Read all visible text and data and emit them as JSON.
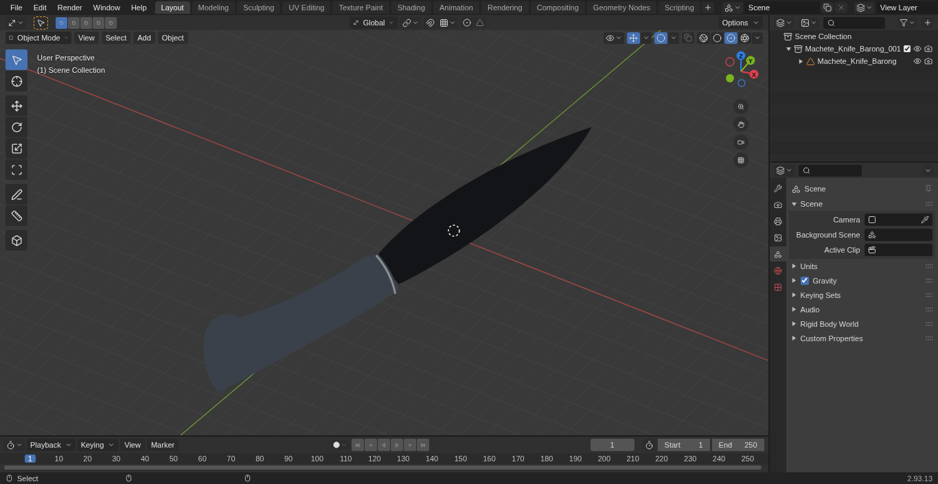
{
  "menu": [
    "File",
    "Edit",
    "Render",
    "Window",
    "Help"
  ],
  "workspaces": [
    {
      "label": "Layout",
      "selected": true
    },
    {
      "label": "Modeling",
      "selected": false
    },
    {
      "label": "Sculpting",
      "selected": false
    },
    {
      "label": "UV Editing",
      "selected": false
    },
    {
      "label": "Texture Paint",
      "selected": false
    },
    {
      "label": "Shading",
      "selected": false
    },
    {
      "label": "Animation",
      "selected": false
    },
    {
      "label": "Rendering",
      "selected": false
    },
    {
      "label": "Compositing",
      "selected": false
    },
    {
      "label": "Geometry Nodes",
      "selected": false
    },
    {
      "label": "Scripting",
      "selected": false
    }
  ],
  "scene": {
    "value": "Scene"
  },
  "view_layer": {
    "value": "View Layer"
  },
  "viewport": {
    "select_modes": [
      {
        "selected": true
      },
      {
        "selected": false
      },
      {
        "selected": false
      },
      {
        "selected": false
      },
      {
        "selected": false
      }
    ],
    "orientation": "Global",
    "options": "Options",
    "mode": "Object Mode",
    "menus": [
      "View",
      "Select",
      "Add",
      "Object"
    ],
    "shading": [
      {
        "kind": "wireframe",
        "selected": false
      },
      {
        "kind": "solid",
        "selected": false
      },
      {
        "kind": "material",
        "selected": true
      },
      {
        "kind": "rendered",
        "selected": false
      }
    ],
    "overlay_lines": [
      "User Perspective",
      "(1) Scene Collection"
    ],
    "tools": [
      [
        {
          "kind": "select",
          "selected": true
        },
        {
          "kind": "cursor",
          "selected": false
        }
      ],
      [
        {
          "kind": "move",
          "selected": false
        },
        {
          "kind": "rotate",
          "selected": false
        },
        {
          "kind": "scale",
          "selected": false
        },
        {
          "kind": "transform",
          "selected": false
        }
      ],
      [
        {
          "kind": "annotate",
          "selected": false
        },
        {
          "kind": "measure",
          "selected": false
        }
      ],
      [
        {
          "kind": "add_cube",
          "selected": false
        }
      ]
    ],
    "gizmo_axes": [
      "Z",
      "Y",
      "X"
    ]
  },
  "outliner": {
    "root": "Scene Collection",
    "items": [
      {
        "label": "Machete_Knife_Barong_001",
        "kind": "collection",
        "expanded": true,
        "checked": true,
        "children": [
          {
            "label": "Machete_Knife_Barong",
            "kind": "object",
            "expanded": false
          }
        ]
      }
    ]
  },
  "properties": {
    "tabs": [
      {
        "kind": "tool",
        "selected": false
      },
      {
        "kind": "render",
        "selected": false
      },
      {
        "kind": "output",
        "selected": false
      },
      {
        "kind": "view_layer",
        "selected": false
      },
      {
        "kind": "scene",
        "selected": true
      },
      {
        "kind": "world",
        "selected": false
      },
      {
        "kind": "texture",
        "selected": false
      }
    ],
    "context": "Scene",
    "panel": {
      "title": "Scene",
      "expanded": true,
      "fields": [
        {
          "label": "Camera",
          "kind": "camera"
        },
        {
          "label": "Background Scene",
          "kind": "scene"
        },
        {
          "label": "Active Clip",
          "kind": "clip"
        }
      ]
    },
    "sections": [
      {
        "label": "Units",
        "kind": "plain",
        "expanded": false
      },
      {
        "label": "Gravity",
        "kind": "checkbox",
        "checked": true,
        "expanded": false
      },
      {
        "label": "Keying Sets",
        "kind": "plain",
        "expanded": false
      },
      {
        "label": "Audio",
        "kind": "plain",
        "expanded": false
      },
      {
        "label": "Rigid Body World",
        "kind": "plain",
        "expanded": false
      },
      {
        "label": "Custom Properties",
        "kind": "plain",
        "expanded": false
      }
    ]
  },
  "timeline": {
    "menus": [
      "Playback",
      "Keying",
      "View",
      "Marker"
    ],
    "current_frame": "1",
    "start": {
      "label": "Start",
      "value": "1"
    },
    "end": {
      "label": "End",
      "value": "250"
    },
    "ruler": [
      {
        "label": "1",
        "selected": true
      },
      {
        "label": "10",
        "selected": false
      },
      {
        "label": "20",
        "selected": false
      },
      {
        "label": "30",
        "selected": false
      },
      {
        "label": "40",
        "selected": false
      },
      {
        "label": "50",
        "selected": false
      },
      {
        "label": "60",
        "selected": false
      },
      {
        "label": "70",
        "selected": false
      },
      {
        "label": "80",
        "selected": false
      },
      {
        "label": "90",
        "selected": false
      },
      {
        "label": "100",
        "selected": false
      },
      {
        "label": "110",
        "selected": false
      },
      {
        "label": "120",
        "selected": false
      },
      {
        "label": "130",
        "selected": false
      },
      {
        "label": "140",
        "selected": false
      },
      {
        "label": "150",
        "selected": false
      },
      {
        "label": "160",
        "selected": false
      },
      {
        "label": "170",
        "selected": false
      },
      {
        "label": "180",
        "selected": false
      },
      {
        "label": "190",
        "selected": false
      },
      {
        "label": "200",
        "selected": false
      },
      {
        "label": "210",
        "selected": false
      },
      {
        "label": "220",
        "selected": false
      },
      {
        "label": "230",
        "selected": false
      },
      {
        "label": "240",
        "selected": false
      },
      {
        "label": "250",
        "selected": false
      }
    ]
  },
  "status_bar": {
    "hint": "Select",
    "version": "2.93.13"
  }
}
